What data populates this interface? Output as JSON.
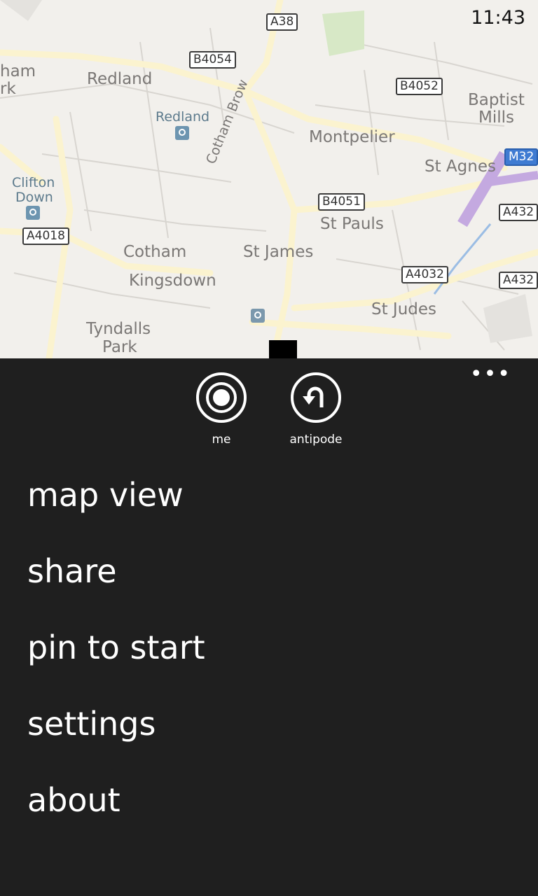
{
  "status_bar": {
    "time": "11:43"
  },
  "map": {
    "places": {
      "redland": "Redland",
      "redland_station": "Redland",
      "montpelier": "Montpelier",
      "baptist": "Baptist",
      "mills": "Mills",
      "st_agnes": "St Agnes",
      "clifton": "Clifton",
      "down": "Down",
      "st_pauls": "St Pauls",
      "cotham": "Cotham",
      "st_james": "St James",
      "kingsdown": "Kingsdown",
      "st_judes": "St Judes",
      "tyndalls": "Tyndalls",
      "park": "Park",
      "ham": "ham",
      "rk": "rk",
      "cotham_brow": "Cotham Brow"
    },
    "roads": {
      "a38": "A38",
      "b4054": "B4054",
      "b4052": "B4052",
      "m32": "M32",
      "b4051": "B4051",
      "a4018": "A4018",
      "a432_1": "A432",
      "a432_2": "A432",
      "a4032": "A4032"
    }
  },
  "appbar": {
    "more": "•••",
    "buttons": [
      {
        "label": "me",
        "icon": "target-icon"
      },
      {
        "label": "antipode",
        "icon": "u-turn-icon"
      }
    ]
  },
  "menu": [
    "map view",
    "share",
    "pin to start",
    "settings",
    "about"
  ]
}
